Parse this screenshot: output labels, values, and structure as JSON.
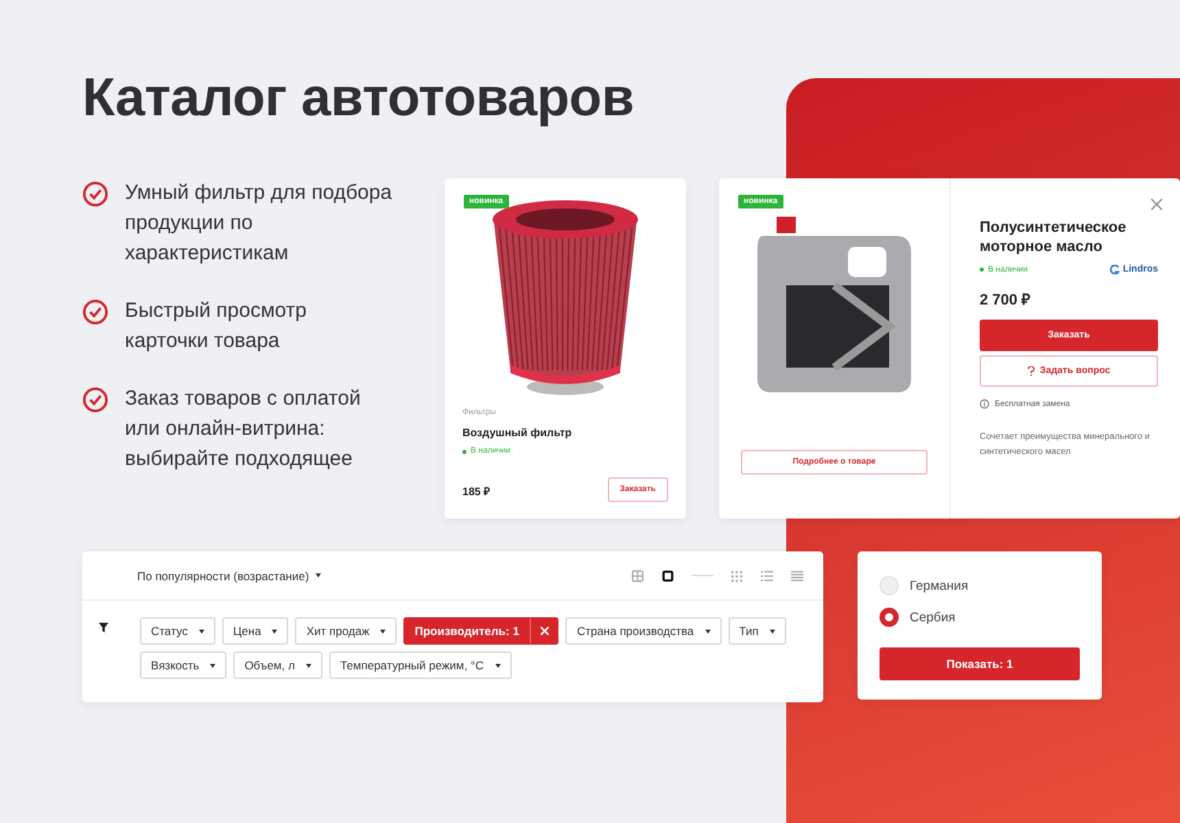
{
  "title": "Каталог автотоваров",
  "features": [
    "Умный фильтр для подбора продукции по характеристикам",
    "Быстрый просмотр карточки товара",
    "Заказ товаров с оплатой или онлайн-витрина: выбирайте подходящее"
  ],
  "product_card": {
    "badge": "новинка",
    "category": "Фильтры",
    "name": "Воздушный фильтр",
    "availability": "В наличии",
    "price": "185 ₽",
    "order_button": "Заказать"
  },
  "quick_view": {
    "badge": "новинка",
    "details_button": "Подробнее о товаре",
    "name": "Полусинтетическое моторное масло",
    "availability": "В наличии",
    "brand": "Lindros",
    "price": "2 700 ₽",
    "order_button": "Заказать",
    "question_button": "Задать вопрос",
    "replacement_note": "Бесплатная замена",
    "description": "Сочетает преимущества минерального и синтетического масел"
  },
  "catalog": {
    "sort": "По популярности (возрастание)",
    "view_modes": [
      {
        "kind": "tiles",
        "selected": false
      },
      {
        "kind": "card",
        "selected": true
      },
      {
        "kind": "grid",
        "selected": false
      },
      {
        "kind": "list",
        "selected": false
      },
      {
        "kind": "table",
        "selected": false
      }
    ],
    "filters": [
      {
        "label": "Статус",
        "active": false
      },
      {
        "label": "Цена",
        "active": false
      },
      {
        "label": "Хит продаж",
        "active": false
      },
      {
        "label": "Производитель: 1",
        "active": true
      },
      {
        "label": "Страна производства",
        "active": false
      },
      {
        "label": "Тип",
        "active": false
      },
      {
        "label": "Вязкость",
        "active": false
      },
      {
        "label": "Объем, л",
        "active": false
      },
      {
        "label": "Температурный режим, °С",
        "active": false
      }
    ]
  },
  "country_popup": {
    "options": [
      {
        "label": "Германия",
        "selected": false
      },
      {
        "label": "Сербия",
        "selected": true
      }
    ],
    "show_button": "Показать: 1"
  }
}
